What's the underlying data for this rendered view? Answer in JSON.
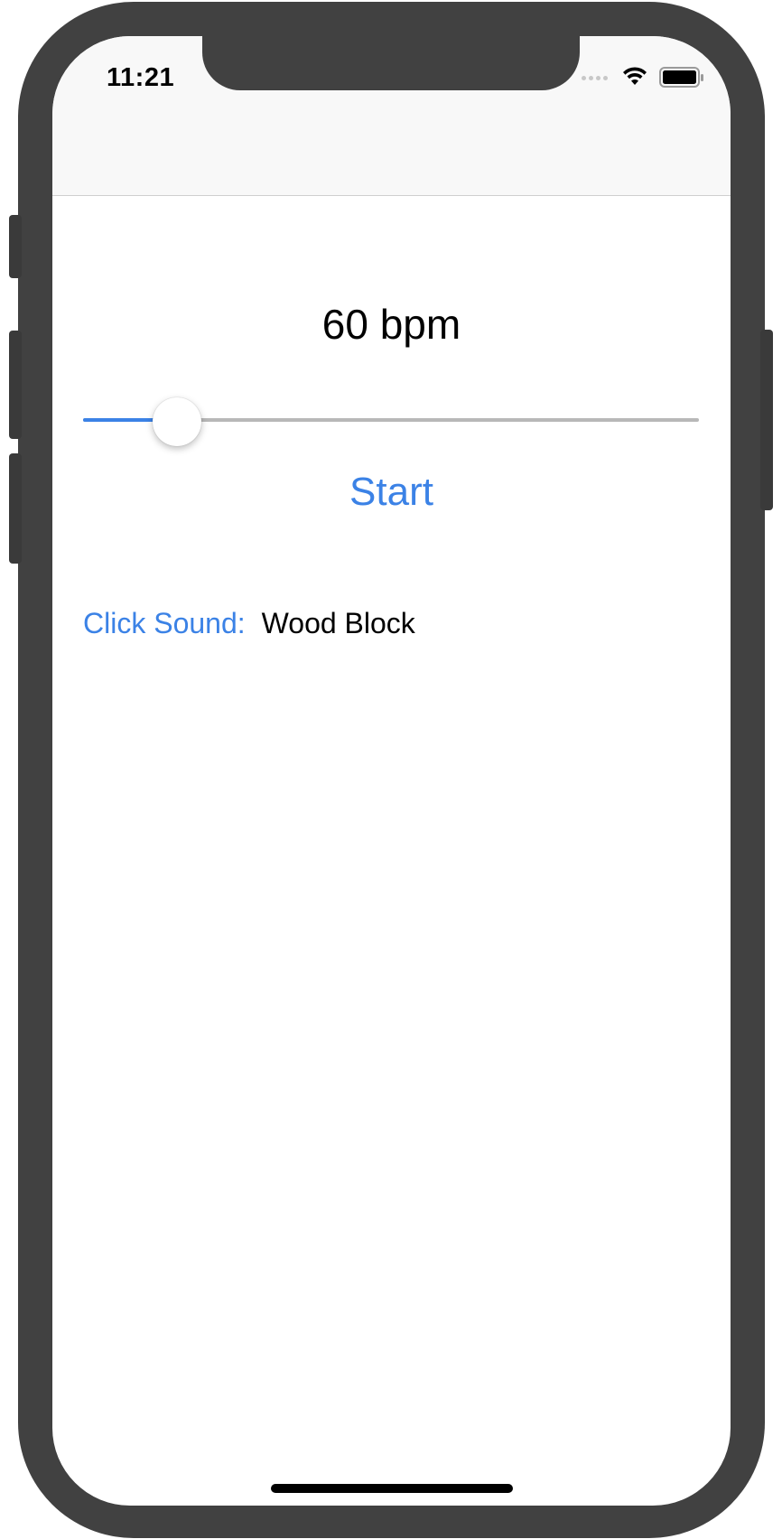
{
  "status_bar": {
    "time": "11:21",
    "icons": [
      "signal-dots-icon",
      "wifi-icon",
      "battery-icon"
    ]
  },
  "tempo": {
    "label": "60 bpm",
    "slider_fraction": 0.152
  },
  "controls": {
    "start_label": "Start"
  },
  "click_sound": {
    "label": "Click Sound:",
    "value": "Wood Block"
  },
  "colors": {
    "accent": "#3b82e6",
    "device_frame": "#414141",
    "nav_bar_bg": "#f8f8f8"
  }
}
